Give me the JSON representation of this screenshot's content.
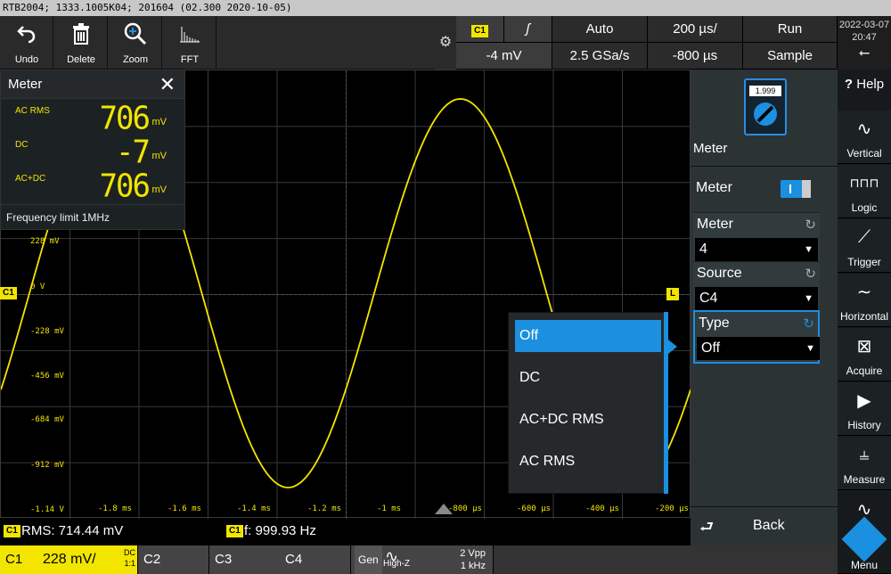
{
  "title_bar": "RTB2004; 1333.1005K04; 201604 (02.300 2020-10-05)",
  "toolbar": {
    "undo": "Undo",
    "delete": "Delete",
    "zoom": "Zoom",
    "fft": "FFT"
  },
  "settings": {
    "trigger_source": "C1",
    "trigger_level": "-4 mV",
    "trigger_mode": "Auto",
    "sample_rate": "2.5 GSa/s",
    "timebase": "200 µs/",
    "position": "-800 µs",
    "run_state": "Run",
    "acq_mode": "Sample"
  },
  "clock": {
    "date": "2022-03-07",
    "time": "20:47"
  },
  "meter_panel": {
    "title": "Meter",
    "rows": [
      {
        "name": "AC RMS",
        "value": "706",
        "unit": "mV"
      },
      {
        "name": "DC",
        "value": "-7",
        "unit": "mV"
      },
      {
        "name": "AC+DC",
        "value": "706",
        "unit": "mV"
      }
    ],
    "footer": "Frequency limit 1MHz"
  },
  "scope": {
    "channel_tag": "C1",
    "y_labels": [
      "228 mV",
      "0 V",
      "-228 mV",
      "-456 mV",
      "-684 mV",
      "-912 mV",
      "-1.14 V"
    ],
    "x_labels": [
      "-1.8 ms",
      "-1.6 ms",
      "-1.4 ms",
      "-1.2 ms",
      "-1 ms",
      "-800 µs",
      "-600 µs",
      "-400 µs",
      "-200 µs"
    ],
    "trace_color": "#f2e500"
  },
  "dropdown": {
    "options": [
      "Off",
      "DC",
      "AC+DC RMS",
      "AC RMS"
    ],
    "selected": "Off"
  },
  "right_panel": {
    "icon_value": "1.999",
    "title": "Meter",
    "meter_toggle_label": "Meter",
    "meter_label": "Meter",
    "meter_value": "4",
    "source_label": "Source",
    "source_value": "C4",
    "type_label": "Type",
    "type_value": "Off",
    "back": "Back"
  },
  "menu": {
    "help": "Help",
    "items": [
      "Vertical",
      "Logic",
      "Trigger",
      "Horizontal",
      "Acquire",
      "History",
      "Measure",
      "Menu"
    ]
  },
  "measurements": {
    "m1_tag": "C1",
    "m1": "RMS: 714.44 mV",
    "m2_tag": "C1",
    "m2": "f: 999.93 Hz"
  },
  "channels": {
    "c1": "C1",
    "c1_scale": "228 mV/",
    "c1_coupling": "DC",
    "c1_probe": "1:1",
    "c2": "C2",
    "c3": "C3",
    "c4": "C4",
    "gen": "Gen",
    "gen_impedance": "High-Z",
    "gen_amplitude": "2 Vpp",
    "gen_freq": "1 kHz"
  }
}
